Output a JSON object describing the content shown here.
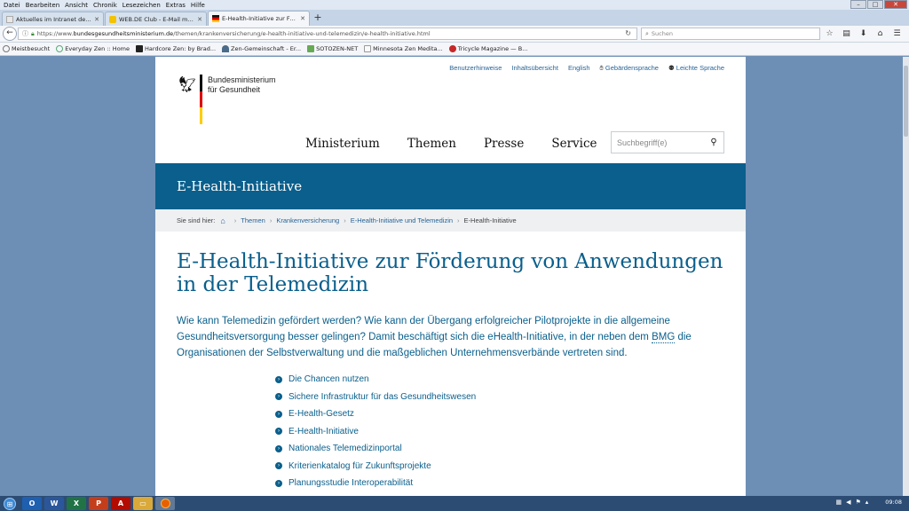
{
  "menubar": {
    "items": [
      "Datei",
      "Bearbeiten",
      "Ansicht",
      "Chronik",
      "Lesezeichen",
      "Extras",
      "Hilfe"
    ]
  },
  "tabs": [
    {
      "label": "Aktuelles im Intranet des BMG",
      "active": false
    },
    {
      "label": "WEB.DE Club - E-Mail mad...",
      "active": false
    },
    {
      "label": "E-Health-Initiative zur Förd...",
      "active": true
    }
  ],
  "address": {
    "url_prefix": "https://www.",
    "url_domain": "bundesgesundheitsministerium.de",
    "url_path": "/themen/krankenversicherung/e-health-initiative-und-telemedizin/e-health-initiative.html"
  },
  "browser_search": {
    "placeholder": "Suchen"
  },
  "bookmarks": [
    "Meistbesucht",
    "Everyday Zen :: Home",
    "Hardcore Zen: by Brad...",
    "Zen-Gemeinschaft - Er...",
    "SOTOZEN-NET",
    "Minnesota Zen Medita...",
    "Tricycle Magazine — B..."
  ],
  "site": {
    "meta_links": [
      "Benutzerhinweise",
      "Inhaltsübersicht",
      "English",
      "Gebärdensprache",
      "Leichte Sprache"
    ],
    "logo_line1": "Bundesministerium",
    "logo_line2": "für Gesundheit",
    "nav": [
      "Ministerium",
      "Themen",
      "Presse",
      "Service"
    ],
    "search_placeholder": "Suchbegriff(e)",
    "banner_title": "E-Health-Initiative",
    "breadcrumb": {
      "label": "Sie sind hier:",
      "items": [
        "Themen",
        "Krankenversicherung",
        "E-Health-Initiative und Telemedizin",
        "E-Health-Initiative"
      ]
    },
    "page_title": "E-Health-Initiative zur Förderung von Anwendungen in der Telemedizin",
    "intro_part1": "Wie kann Telemedizin gefördert werden? Wie kann der Übergang erfolgreicher Pilotprojekte in die allgemeine Gesundheitsversorgung besser gelingen? Damit beschäftigt sich die eHealth-Initiative, in der neben dem ",
    "intro_abbr": "BMG",
    "intro_part2": " die Organisationen der Selbstverwaltung und die maßgeblichen Unternehmensverbände vertreten sind.",
    "links": [
      "Die Chancen nutzen",
      "Sichere Infrastruktur für das Gesundheitswesen",
      "E-Health-Gesetz",
      "E-Health-Initiative",
      "Nationales Telemedizinportal",
      "Kriterienkatalog für Zukunftsprojekte",
      "Planungsstudie Interoperabilität"
    ]
  },
  "taskbar": {
    "clock": "09:08"
  },
  "colors": {
    "brand_blue": "#0a5f8c",
    "link_blue": "#2a6496",
    "desktop_blue": "#6e8fb5"
  }
}
